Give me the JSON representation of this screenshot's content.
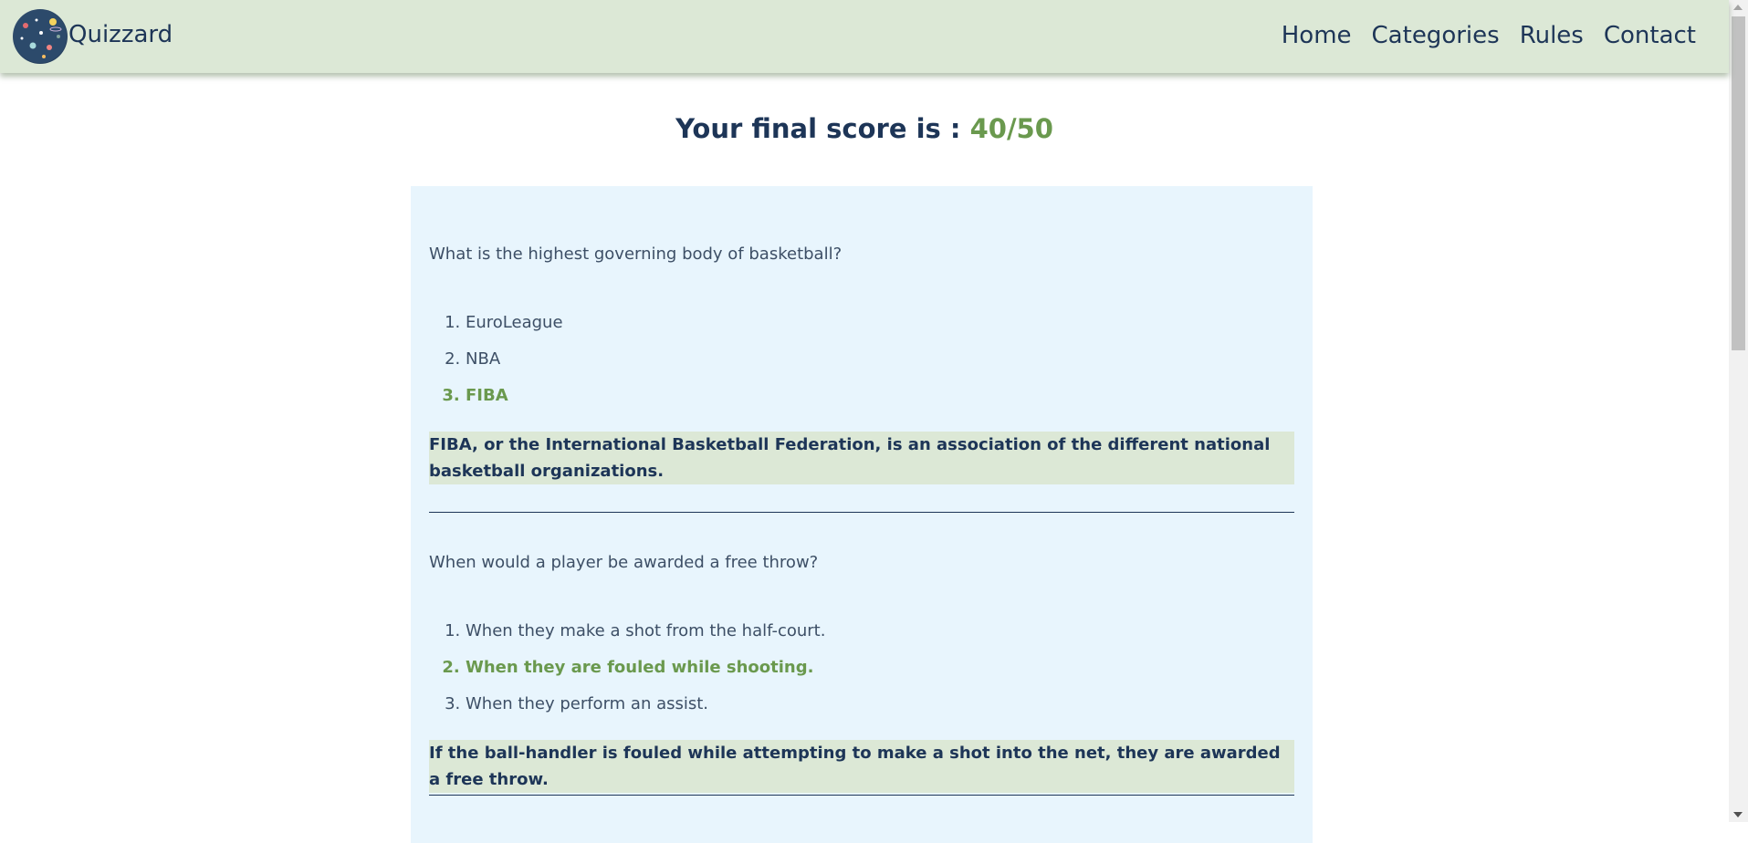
{
  "header": {
    "brand": "Quizzard",
    "logo_icon": "galaxy-logo-icon",
    "nav": [
      "Home",
      "Categories",
      "Rules",
      "Contact"
    ]
  },
  "score": {
    "label": "Your final score is :",
    "value": "40/50"
  },
  "questions": [
    {
      "text": "What is the highest governing body of basketball?",
      "options": [
        "EuroLeague",
        "NBA",
        "FIBA"
      ],
      "correct_index": 2,
      "explanation": "FIBA, or the International Basketball Federation, is an association of the different national basketball organizations."
    },
    {
      "text": "When would a player be awarded a free throw?",
      "options": [
        "When they make a shot from the half-court.",
        "When they are fouled while shooting.",
        "When they perform an assist."
      ],
      "correct_index": 1,
      "explanation": "If the ball-handler is fouled while attempting to make a shot into the net, they are awarded a free throw."
    }
  ],
  "colors": {
    "header_bg": "#dce8d6",
    "navy": "#1d3557",
    "correct_green": "#6a994e",
    "panel_bg": "#e8f5fd"
  }
}
